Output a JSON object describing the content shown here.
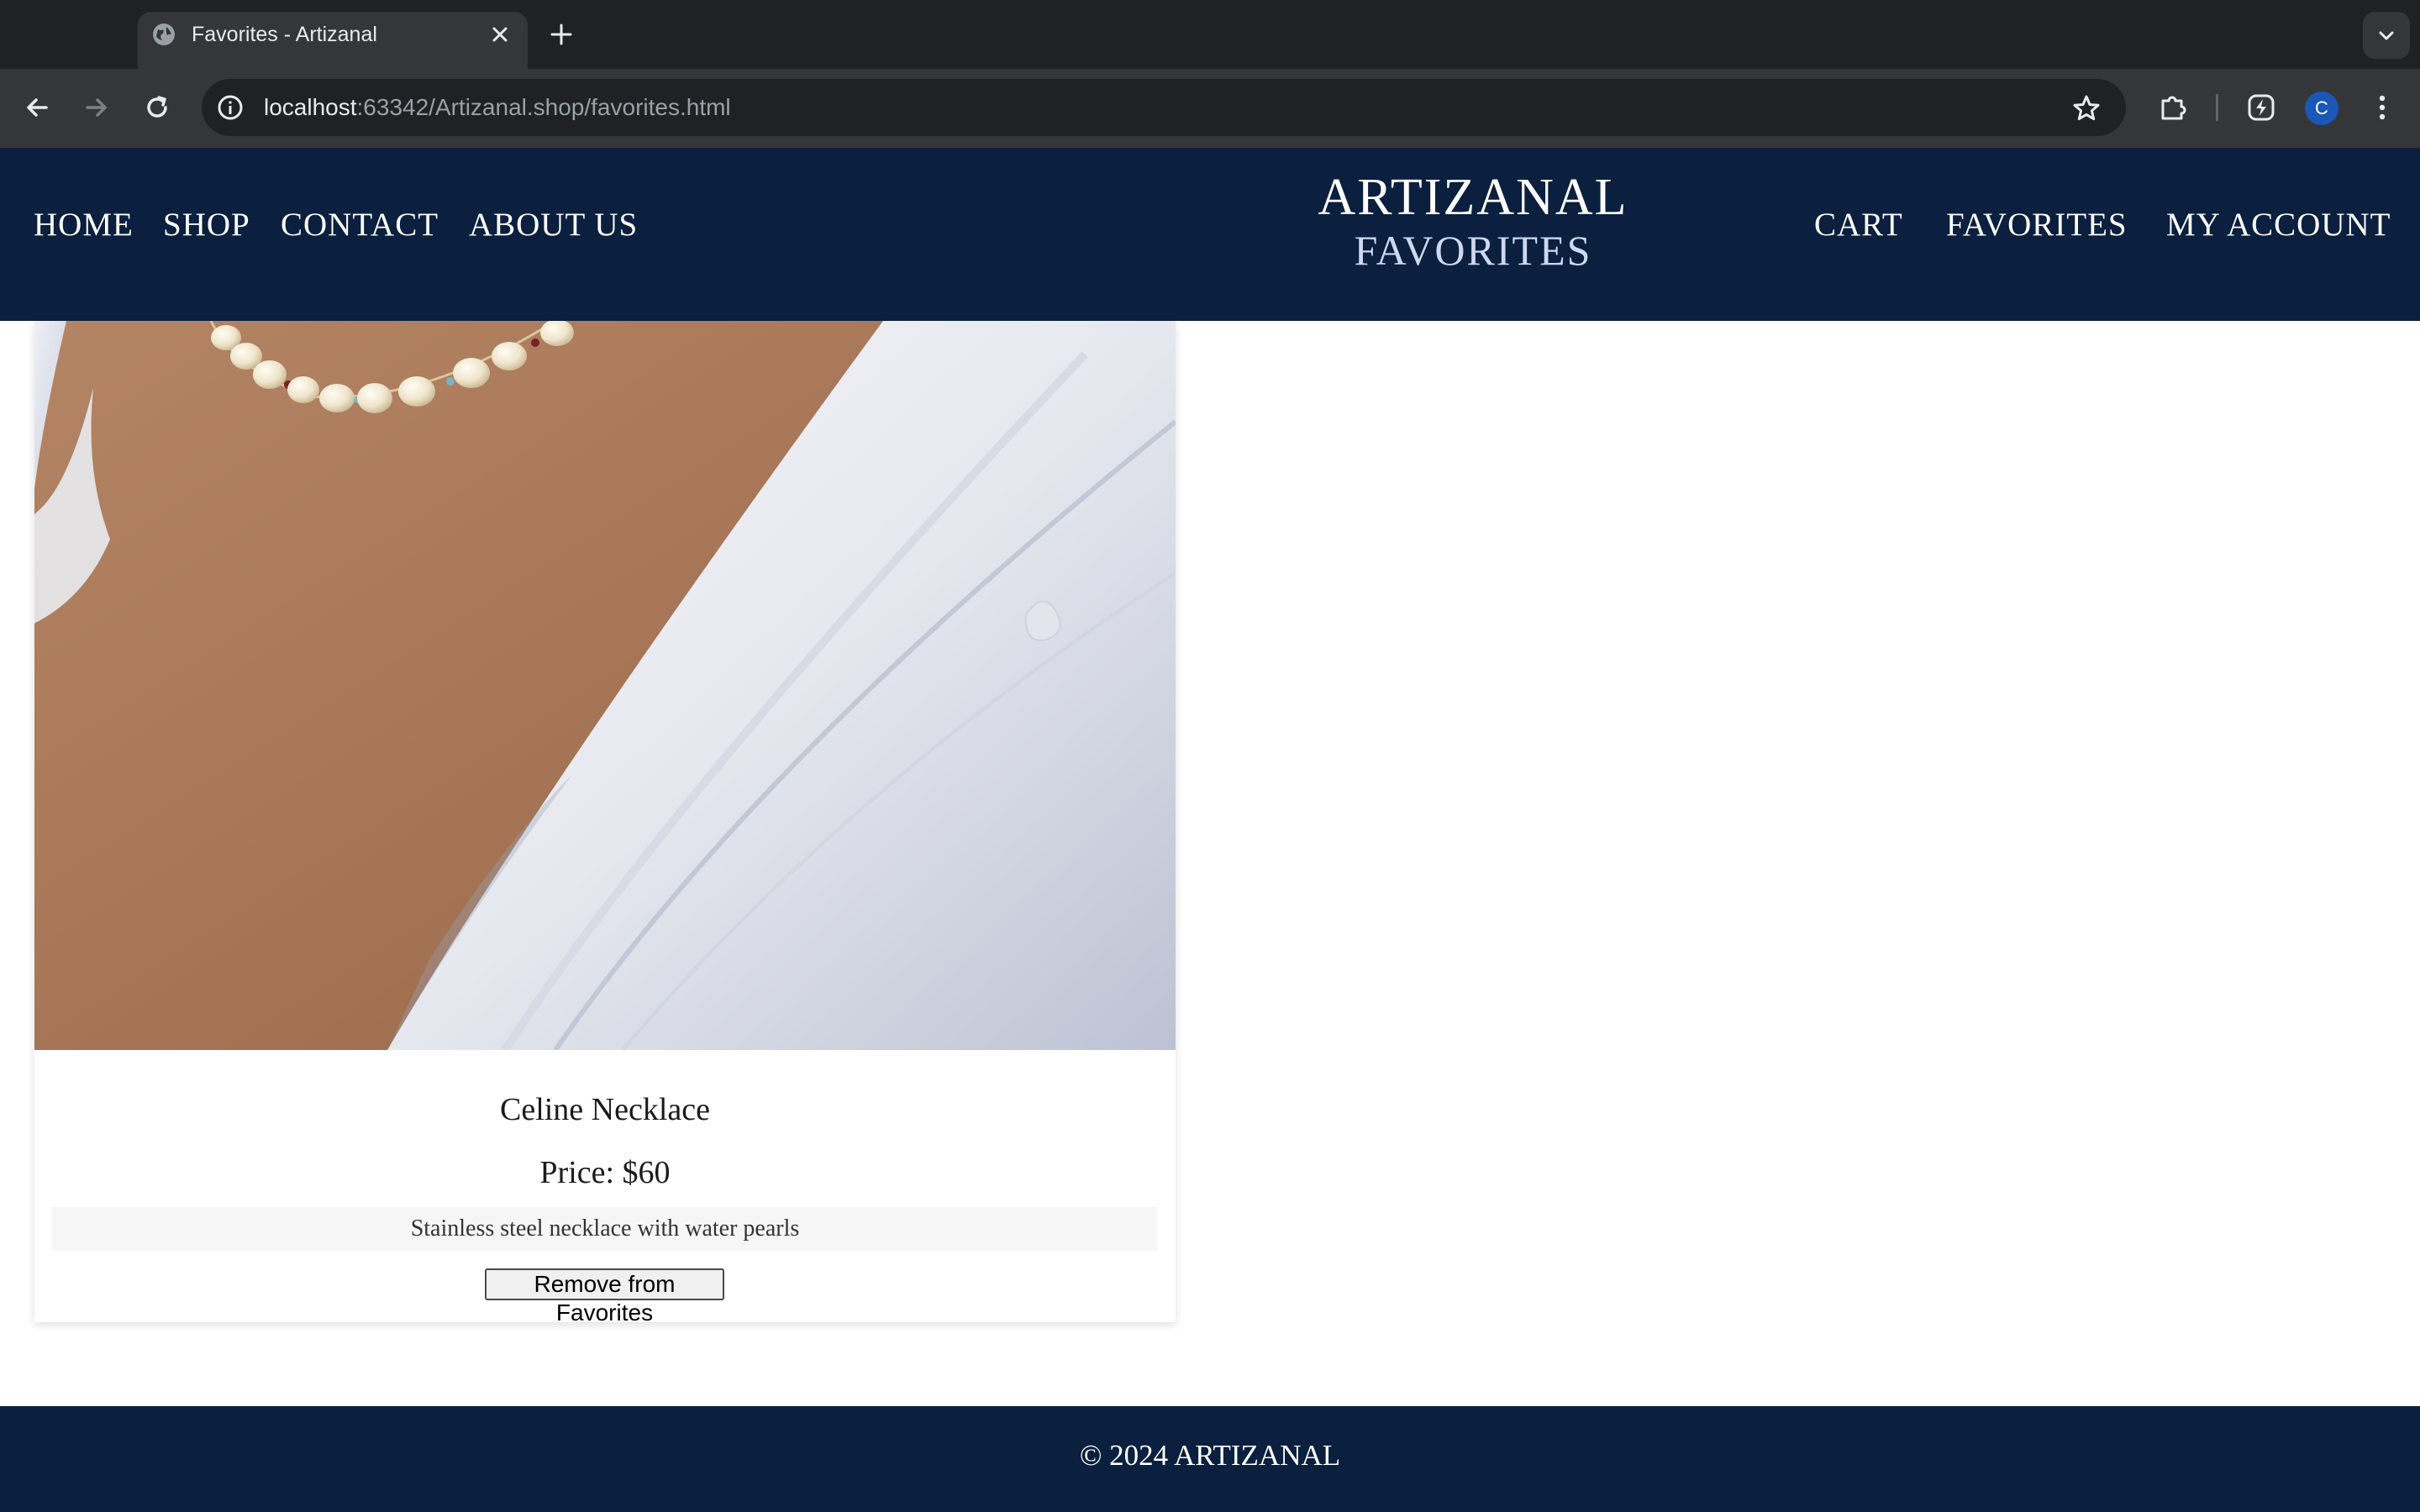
{
  "browser": {
    "tab_title": "Favorites - Artizanal",
    "url_host": "localhost",
    "url_rest": ":63342/Artizanal.shop/favorites.html",
    "profile_initial": "C"
  },
  "header": {
    "nav_left": [
      "HOME",
      "SHOP",
      "CONTACT",
      "ABOUT US"
    ],
    "brand": "ARTIZANAL",
    "page_title": "FAVORITES",
    "nav_right": [
      "CART",
      "FAVORITES",
      "MY ACCOUNT"
    ],
    "background": "#0b1f3f"
  },
  "favorites": [
    {
      "name": "Celine Necklace",
      "price": "Price: $60",
      "description": "Stainless steel necklace with water pearls",
      "remove_label": "Remove from Favorites"
    }
  ],
  "footer": {
    "text": "© 2024 ARTIZANAL"
  },
  "icons": {
    "favicon": "globe-icon",
    "tab_close": "close-icon",
    "new_tab": "plus-icon",
    "back": "arrow-left-icon",
    "forward": "arrow-right-icon",
    "reload": "reload-icon",
    "site_info": "info-icon",
    "bookmark": "star-icon",
    "extensions": "puzzle-icon",
    "performance": "gauge-icon",
    "menu": "kebab-icon"
  }
}
